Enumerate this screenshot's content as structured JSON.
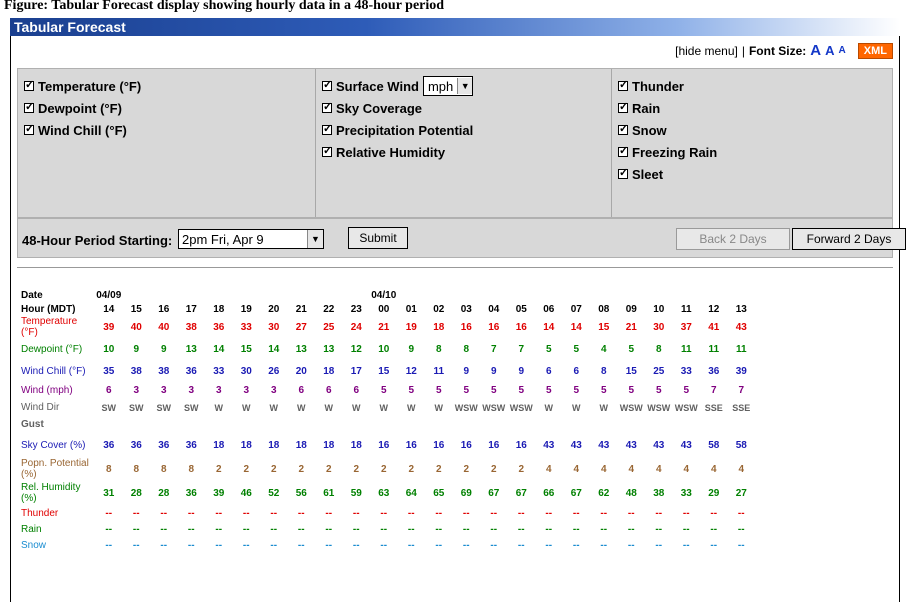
{
  "caption": "Figure: Tabular Forecast display showing hourly data in a 48-hour period",
  "title": "Tabular Forecast",
  "toplinks": {
    "hide_menu": "[hide menu]",
    "separator": "|",
    "font_size_label": "Font Size:",
    "font_large": "A",
    "font_medium": "A",
    "font_small": "A",
    "xml": "XML"
  },
  "options": {
    "col1": [
      "Temperature (°F)",
      "Dewpoint (°F)",
      "Wind Chill (°F)"
    ],
    "col2": [
      "Surface Wind",
      "Sky Coverage",
      "Precipitation Potential",
      "Relative Humidity"
    ],
    "wind_unit": "mph",
    "col3": [
      "Thunder",
      "Rain",
      "Snow",
      "Freezing Rain",
      "Sleet"
    ]
  },
  "period": {
    "label": "48-Hour Period Starting:",
    "value": "2pm Fri, Apr 9",
    "submit": "Submit",
    "back": "Back 2 Days",
    "forward": "Forward 2 Days"
  },
  "colors": {
    "title_bar": "#2e5cb8",
    "temperature": "#e00000",
    "dewpoint": "#008000",
    "windchill": "#1a1ab4",
    "wind": "#800080",
    "wind_dir": "#606060",
    "sky": "#1a1ab4",
    "popn": "#996633",
    "humidity": "#008000",
    "thunder": "#e00000",
    "rain": "#008000",
    "snow": "#1a8cd0"
  },
  "table": {
    "dates": [
      {
        "col": 0,
        "label": "04/09"
      },
      {
        "col": 10,
        "label": "04/10"
      }
    ],
    "hours": [
      "14",
      "15",
      "16",
      "17",
      "18",
      "19",
      "20",
      "21",
      "22",
      "23",
      "00",
      "01",
      "02",
      "03",
      "04",
      "05",
      "06",
      "07",
      "08",
      "09",
      "10",
      "11",
      "12",
      "13"
    ],
    "rows": [
      {
        "key": "date",
        "label": "Date"
      },
      {
        "key": "hour",
        "label": "Hour (MDT)"
      },
      {
        "key": "temperature",
        "label": "Temperature (°F)",
        "values": [
          "39",
          "40",
          "40",
          "38",
          "36",
          "33",
          "30",
          "27",
          "25",
          "24",
          "21",
          "19",
          "18",
          "16",
          "16",
          "16",
          "14",
          "14",
          "15",
          "21",
          "30",
          "37",
          "41",
          "43"
        ]
      },
      {
        "key": "dewpoint",
        "label": "Dewpoint (°F)",
        "values": [
          "10",
          "9",
          "9",
          "13",
          "14",
          "15",
          "14",
          "13",
          "13",
          "12",
          "10",
          "9",
          "8",
          "8",
          "7",
          "7",
          "5",
          "5",
          "4",
          "5",
          "8",
          "11",
          "11",
          "11"
        ]
      },
      {
        "key": "windchill",
        "label": "Wind Chill (°F)",
        "values": [
          "35",
          "38",
          "38",
          "36",
          "33",
          "30",
          "26",
          "20",
          "18",
          "17",
          "15",
          "12",
          "11",
          "9",
          "9",
          "9",
          "6",
          "6",
          "8",
          "15",
          "25",
          "33",
          "36",
          "39"
        ]
      },
      {
        "key": "wind",
        "label": "Wind (mph)",
        "values": [
          "6",
          "3",
          "3",
          "3",
          "3",
          "3",
          "3",
          "6",
          "6",
          "6",
          "5",
          "5",
          "5",
          "5",
          "5",
          "5",
          "5",
          "5",
          "5",
          "5",
          "5",
          "5",
          "7",
          "7"
        ]
      },
      {
        "key": "wind_dir",
        "label": "Wind Dir",
        "values": [
          "SW",
          "SW",
          "SW",
          "SW",
          "W",
          "W",
          "W",
          "W",
          "W",
          "W",
          "W",
          "W",
          "W",
          "WSW",
          "WSW",
          "WSW",
          "W",
          "W",
          "W",
          "WSW",
          "WSW",
          "WSW",
          "SSE",
          "SSE"
        ]
      },
      {
        "key": "gust",
        "label": "Gust",
        "values": [
          "",
          "",
          "",
          "",
          "",
          "",
          "",
          "",
          "",
          "",
          "",
          "",
          "",
          "",
          "",
          "",
          "",
          "",
          "",
          "",
          "",
          "",
          "",
          ""
        ]
      },
      {
        "key": "sky",
        "label": "Sky Cover (%)",
        "values": [
          "36",
          "36",
          "36",
          "36",
          "18",
          "18",
          "18",
          "18",
          "18",
          "18",
          "16",
          "16",
          "16",
          "16",
          "16",
          "16",
          "43",
          "43",
          "43",
          "43",
          "43",
          "43",
          "58",
          "58"
        ]
      },
      {
        "key": "popn",
        "label": "Popn. Potential (%)",
        "values": [
          "8",
          "8",
          "8",
          "8",
          "2",
          "2",
          "2",
          "2",
          "2",
          "2",
          "2",
          "2",
          "2",
          "2",
          "2",
          "2",
          "4",
          "4",
          "4",
          "4",
          "4",
          "4",
          "4",
          "4"
        ]
      },
      {
        "key": "humidity",
        "label": "Rel. Humidity (%)",
        "values": [
          "31",
          "28",
          "28",
          "36",
          "39",
          "46",
          "52",
          "56",
          "61",
          "59",
          "63",
          "64",
          "65",
          "69",
          "67",
          "67",
          "66",
          "67",
          "62",
          "48",
          "38",
          "33",
          "29",
          "27"
        ]
      },
      {
        "key": "thunder",
        "label": "Thunder",
        "values": [
          "--",
          "--",
          "--",
          "--",
          "--",
          "--",
          "--",
          "--",
          "--",
          "--",
          "--",
          "--",
          "--",
          "--",
          "--",
          "--",
          "--",
          "--",
          "--",
          "--",
          "--",
          "--",
          "--",
          "--"
        ]
      },
      {
        "key": "rain",
        "label": "Rain",
        "values": [
          "--",
          "--",
          "--",
          "--",
          "--",
          "--",
          "--",
          "--",
          "--",
          "--",
          "--",
          "--",
          "--",
          "--",
          "--",
          "--",
          "--",
          "--",
          "--",
          "--",
          "--",
          "--",
          "--",
          "--"
        ]
      },
      {
        "key": "snow",
        "label": "Snow",
        "values": [
          "--",
          "--",
          "--",
          "--",
          "--",
          "--",
          "--",
          "--",
          "--",
          "--",
          "--",
          "--",
          "--",
          "--",
          "--",
          "--",
          "--",
          "--",
          "--",
          "--",
          "--",
          "--",
          "--",
          "--"
        ]
      }
    ]
  }
}
